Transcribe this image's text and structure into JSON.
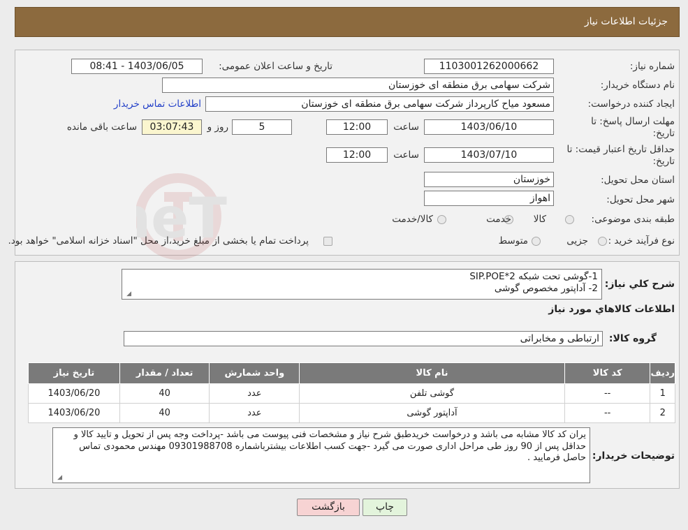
{
  "header": {
    "title": "جزئیات اطلاعات نیاز"
  },
  "form": {
    "need_number_label": "شماره نیاز:",
    "need_number": "1103001262000662",
    "announce_label": "تاریخ و ساعت اعلان عمومی:",
    "announce_value": "1403/06/05 - 08:41",
    "buyer_org_label": "نام دستگاه خریدار:",
    "buyer_org": "شرکت سهامی برق منطقه ای خوزستان",
    "creator_label": "ایجاد کننده درخواست:",
    "creator": "مسعود میاح کارپرداز شرکت سهامی برق منطقه ای خوزستان",
    "contact_link": "اطلاعات تماس خریدار",
    "deadline_label": "مهلت ارسال پاسخ: تا تاریخ:",
    "deadline_date": "1403/06/10",
    "time_label": "ساعت",
    "deadline_time": "12:00",
    "days_value": "5",
    "days_label": "روز و",
    "remaining_time": "03:07:43",
    "remaining_label": "ساعت باقی مانده",
    "price_validity_label": "حداقل تاریخ اعتبار قیمت: تا تاریخ:",
    "price_validity_date": "1403/07/10",
    "price_validity_time": "12:00",
    "province_label": "استان محل تحویل:",
    "province": "خوزستان",
    "city_label": "شهر محل تحویل:",
    "city": "اهواز",
    "category_label": "طبقه بندی موضوعی:",
    "category_options": [
      "کالا",
      "خدمت",
      "کالا/خدمت"
    ],
    "process_label": "نوع فرآیند خرید :",
    "process_options": [
      "جزیی",
      "متوسط"
    ],
    "process_note": "پرداخت تمام یا بخشی از مبلغ خرید،از محل \"اسناد خزانه اسلامی\" خواهد بود."
  },
  "details": {
    "summary_label": "شرح کلي نياز:",
    "summary_line1": "1-گوشی تحت شبکه SIP.POE*2",
    "summary_line2": "2- آداپتور مخصوص گوشی",
    "goods_info_title": "اطلاعات کالاهاي مورد نياز",
    "goods_group_label": "گروه کالا:",
    "goods_group": "ارتباطی و مخابراتی",
    "table_headers": [
      "رديف",
      "کد کالا",
      "نام کالا",
      "واحد شمارش",
      "تعداد / مقدار",
      "تاريخ نياز"
    ],
    "rows": [
      [
        "1",
        "--",
        "گوشی تلفن",
        "عدد",
        "40",
        "1403/06/20"
      ],
      [
        "2",
        "--",
        "آداپتور گوشی",
        "عدد",
        "40",
        "1403/06/20"
      ]
    ],
    "buyer_notes_label": "توضیحات خریدار:",
    "buyer_notes": "یران کد کالا مشابه می باشد و درخواست خریدطبق شرح نیاز و مشخصات فنی پیوست می باشد -پرداخت وجه پس از تحویل و تایید کالا و حداقل پس از 90 روز طی مراحل اداری صورت می گیرد -جهت کسب اطلاعات بیشترباشماره 09301988708 مهندس محمودی تماس حاصل فرمایید ."
  },
  "buttons": {
    "print": "چاپ",
    "back": "بازگشت"
  },
  "watermark_text": "AriaTender.neT",
  "colors": {
    "header_bg": "#8c6a3e",
    "link": "#2340c8",
    "remaining_bg": "#fbf6cf",
    "back_btn_bg": "#f7d3d3",
    "print_btn_bg": "#e3f4dc"
  }
}
